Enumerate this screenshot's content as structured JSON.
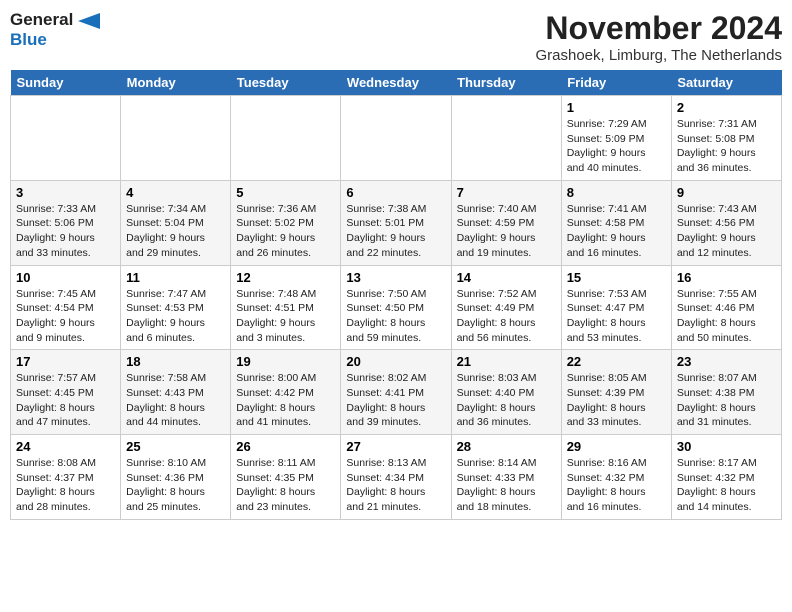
{
  "logo": {
    "line1": "General",
    "line2": "Blue"
  },
  "title": "November 2024",
  "location": "Grashoek, Limburg, The Netherlands",
  "days_of_week": [
    "Sunday",
    "Monday",
    "Tuesday",
    "Wednesday",
    "Thursday",
    "Friday",
    "Saturday"
  ],
  "weeks": [
    [
      {
        "day": "",
        "sunrise": "",
        "sunset": "",
        "daylight": ""
      },
      {
        "day": "",
        "sunrise": "",
        "sunset": "",
        "daylight": ""
      },
      {
        "day": "",
        "sunrise": "",
        "sunset": "",
        "daylight": ""
      },
      {
        "day": "",
        "sunrise": "",
        "sunset": "",
        "daylight": ""
      },
      {
        "day": "",
        "sunrise": "",
        "sunset": "",
        "daylight": ""
      },
      {
        "day": "1",
        "sunrise": "Sunrise: 7:29 AM",
        "sunset": "Sunset: 5:09 PM",
        "daylight": "Daylight: 9 hours and 40 minutes."
      },
      {
        "day": "2",
        "sunrise": "Sunrise: 7:31 AM",
        "sunset": "Sunset: 5:08 PM",
        "daylight": "Daylight: 9 hours and 36 minutes."
      }
    ],
    [
      {
        "day": "3",
        "sunrise": "Sunrise: 7:33 AM",
        "sunset": "Sunset: 5:06 PM",
        "daylight": "Daylight: 9 hours and 33 minutes."
      },
      {
        "day": "4",
        "sunrise": "Sunrise: 7:34 AM",
        "sunset": "Sunset: 5:04 PM",
        "daylight": "Daylight: 9 hours and 29 minutes."
      },
      {
        "day": "5",
        "sunrise": "Sunrise: 7:36 AM",
        "sunset": "Sunset: 5:02 PM",
        "daylight": "Daylight: 9 hours and 26 minutes."
      },
      {
        "day": "6",
        "sunrise": "Sunrise: 7:38 AM",
        "sunset": "Sunset: 5:01 PM",
        "daylight": "Daylight: 9 hours and 22 minutes."
      },
      {
        "day": "7",
        "sunrise": "Sunrise: 7:40 AM",
        "sunset": "Sunset: 4:59 PM",
        "daylight": "Daylight: 9 hours and 19 minutes."
      },
      {
        "day": "8",
        "sunrise": "Sunrise: 7:41 AM",
        "sunset": "Sunset: 4:58 PM",
        "daylight": "Daylight: 9 hours and 16 minutes."
      },
      {
        "day": "9",
        "sunrise": "Sunrise: 7:43 AM",
        "sunset": "Sunset: 4:56 PM",
        "daylight": "Daylight: 9 hours and 12 minutes."
      }
    ],
    [
      {
        "day": "10",
        "sunrise": "Sunrise: 7:45 AM",
        "sunset": "Sunset: 4:54 PM",
        "daylight": "Daylight: 9 hours and 9 minutes."
      },
      {
        "day": "11",
        "sunrise": "Sunrise: 7:47 AM",
        "sunset": "Sunset: 4:53 PM",
        "daylight": "Daylight: 9 hours and 6 minutes."
      },
      {
        "day": "12",
        "sunrise": "Sunrise: 7:48 AM",
        "sunset": "Sunset: 4:51 PM",
        "daylight": "Daylight: 9 hours and 3 minutes."
      },
      {
        "day": "13",
        "sunrise": "Sunrise: 7:50 AM",
        "sunset": "Sunset: 4:50 PM",
        "daylight": "Daylight: 8 hours and 59 minutes."
      },
      {
        "day": "14",
        "sunrise": "Sunrise: 7:52 AM",
        "sunset": "Sunset: 4:49 PM",
        "daylight": "Daylight: 8 hours and 56 minutes."
      },
      {
        "day": "15",
        "sunrise": "Sunrise: 7:53 AM",
        "sunset": "Sunset: 4:47 PM",
        "daylight": "Daylight: 8 hours and 53 minutes."
      },
      {
        "day": "16",
        "sunrise": "Sunrise: 7:55 AM",
        "sunset": "Sunset: 4:46 PM",
        "daylight": "Daylight: 8 hours and 50 minutes."
      }
    ],
    [
      {
        "day": "17",
        "sunrise": "Sunrise: 7:57 AM",
        "sunset": "Sunset: 4:45 PM",
        "daylight": "Daylight: 8 hours and 47 minutes."
      },
      {
        "day": "18",
        "sunrise": "Sunrise: 7:58 AM",
        "sunset": "Sunset: 4:43 PM",
        "daylight": "Daylight: 8 hours and 44 minutes."
      },
      {
        "day": "19",
        "sunrise": "Sunrise: 8:00 AM",
        "sunset": "Sunset: 4:42 PM",
        "daylight": "Daylight: 8 hours and 41 minutes."
      },
      {
        "day": "20",
        "sunrise": "Sunrise: 8:02 AM",
        "sunset": "Sunset: 4:41 PM",
        "daylight": "Daylight: 8 hours and 39 minutes."
      },
      {
        "day": "21",
        "sunrise": "Sunrise: 8:03 AM",
        "sunset": "Sunset: 4:40 PM",
        "daylight": "Daylight: 8 hours and 36 minutes."
      },
      {
        "day": "22",
        "sunrise": "Sunrise: 8:05 AM",
        "sunset": "Sunset: 4:39 PM",
        "daylight": "Daylight: 8 hours and 33 minutes."
      },
      {
        "day": "23",
        "sunrise": "Sunrise: 8:07 AM",
        "sunset": "Sunset: 4:38 PM",
        "daylight": "Daylight: 8 hours and 31 minutes."
      }
    ],
    [
      {
        "day": "24",
        "sunrise": "Sunrise: 8:08 AM",
        "sunset": "Sunset: 4:37 PM",
        "daylight": "Daylight: 8 hours and 28 minutes."
      },
      {
        "day": "25",
        "sunrise": "Sunrise: 8:10 AM",
        "sunset": "Sunset: 4:36 PM",
        "daylight": "Daylight: 8 hours and 25 minutes."
      },
      {
        "day": "26",
        "sunrise": "Sunrise: 8:11 AM",
        "sunset": "Sunset: 4:35 PM",
        "daylight": "Daylight: 8 hours and 23 minutes."
      },
      {
        "day": "27",
        "sunrise": "Sunrise: 8:13 AM",
        "sunset": "Sunset: 4:34 PM",
        "daylight": "Daylight: 8 hours and 21 minutes."
      },
      {
        "day": "28",
        "sunrise": "Sunrise: 8:14 AM",
        "sunset": "Sunset: 4:33 PM",
        "daylight": "Daylight: 8 hours and 18 minutes."
      },
      {
        "day": "29",
        "sunrise": "Sunrise: 8:16 AM",
        "sunset": "Sunset: 4:32 PM",
        "daylight": "Daylight: 8 hours and 16 minutes."
      },
      {
        "day": "30",
        "sunrise": "Sunrise: 8:17 AM",
        "sunset": "Sunset: 4:32 PM",
        "daylight": "Daylight: 8 hours and 14 minutes."
      }
    ]
  ]
}
